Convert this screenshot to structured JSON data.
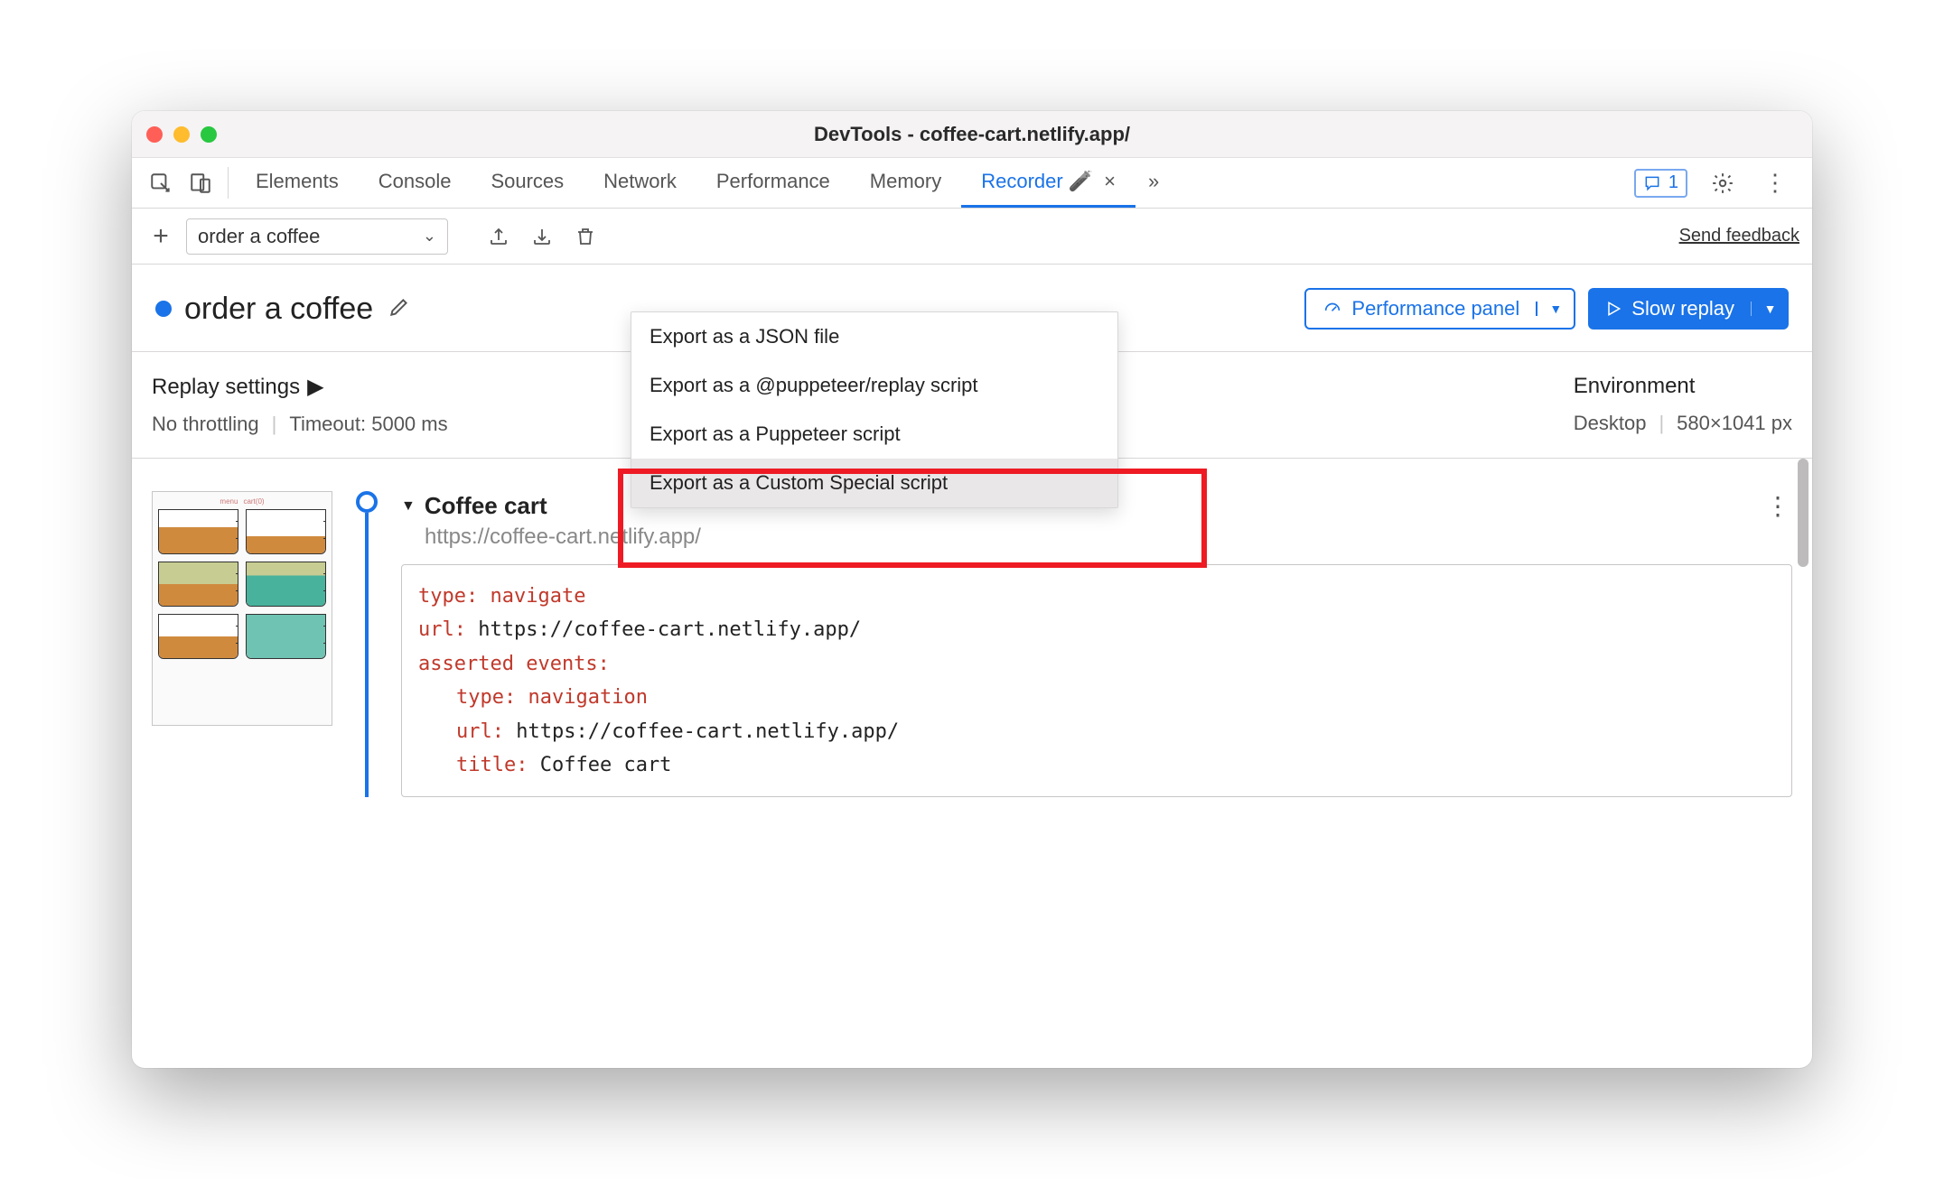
{
  "window": {
    "title": "DevTools - coffee-cart.netlify.app/"
  },
  "tabs": {
    "items": [
      "Elements",
      "Console",
      "Sources",
      "Network",
      "Performance",
      "Memory",
      "Recorder"
    ],
    "active": "Recorder",
    "flask": "🧪",
    "overflow": "»",
    "issue_count": "1"
  },
  "toolbar": {
    "recording_name": "order a coffee",
    "feedback": "Send feedback"
  },
  "export_menu": {
    "items": [
      "Export as a JSON file",
      "Export as a @puppeteer/replay script",
      "Export as a Puppeteer script",
      "Export as a Custom Special script"
    ],
    "selected_index": 3
  },
  "header": {
    "title": "order a coffee",
    "perf_button": "Performance panel",
    "replay_button": "Slow replay"
  },
  "settings": {
    "label": "Replay settings",
    "throttling": "No throttling",
    "timeout": "Timeout: 5000 ms",
    "env_label": "Environment",
    "env_device": "Desktop",
    "env_size": "580×1041 px"
  },
  "step": {
    "name": "Coffee cart",
    "url": "https://coffee-cart.netlify.app/",
    "code": {
      "l1k": "type:",
      "l1v": "navigate",
      "l2k": "url:",
      "l2v": "https://coffee-cart.netlify.app/",
      "l3k": "asserted events:",
      "l4k": "type:",
      "l4v": "navigation",
      "l5k": "url:",
      "l5v": "https://coffee-cart.netlify.app/",
      "l6k": "title:",
      "l6v": "Coffee cart"
    }
  }
}
